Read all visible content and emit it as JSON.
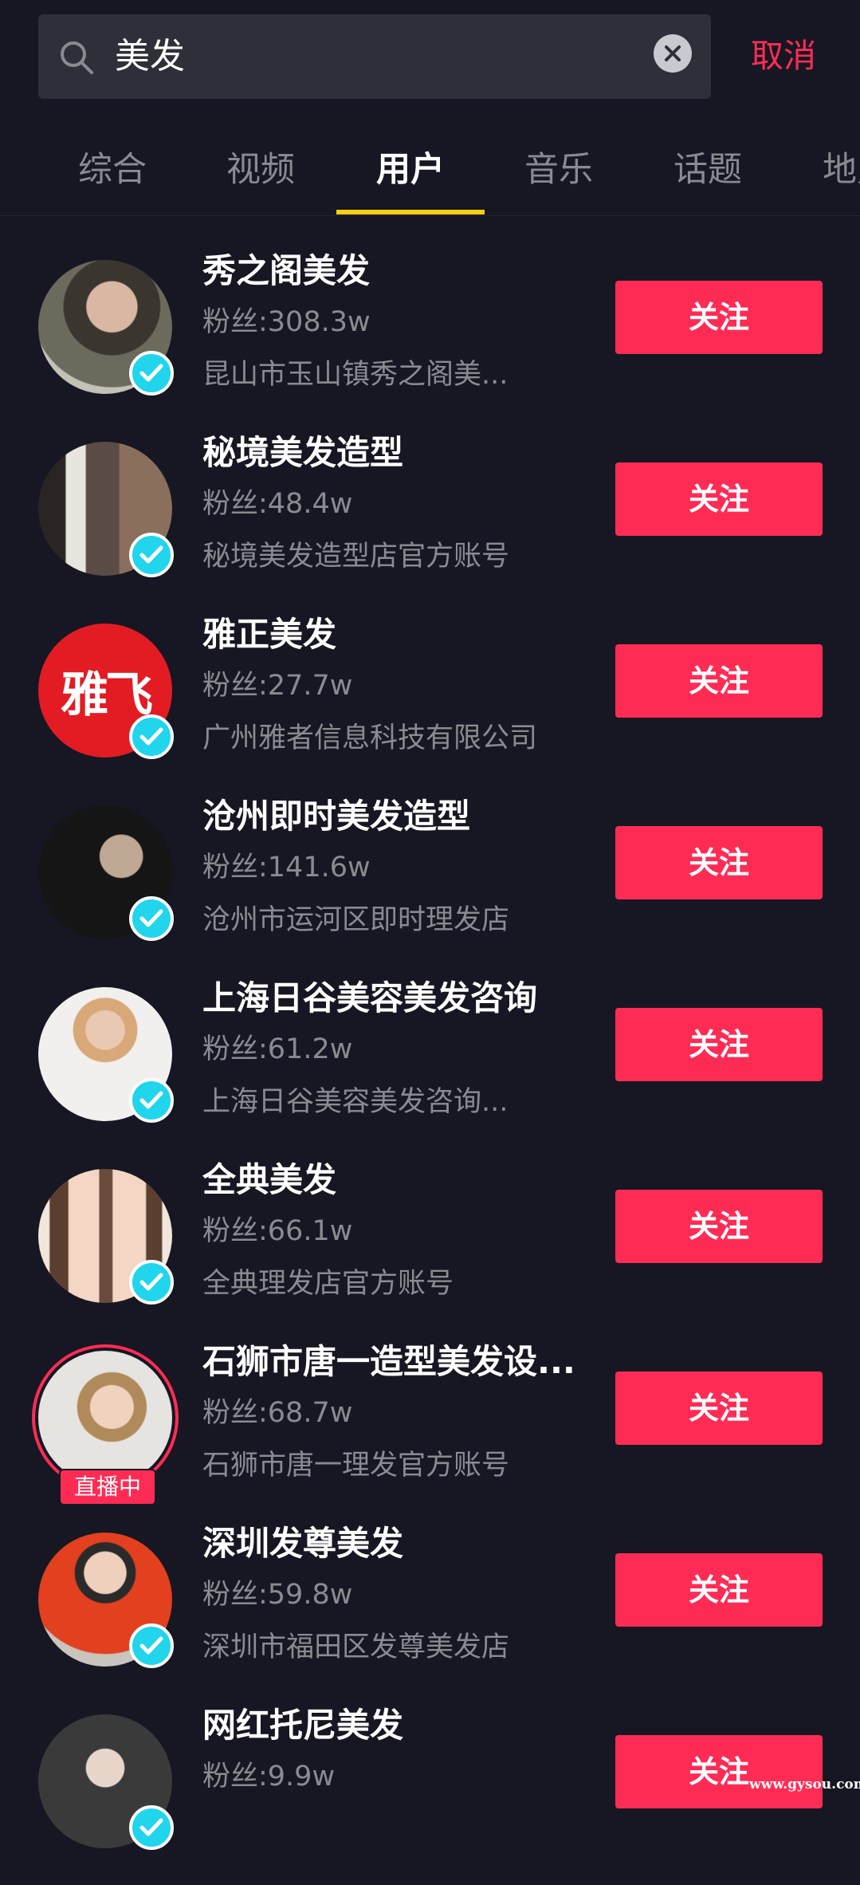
{
  "search": {
    "query": "美发",
    "cancel_label": "取消"
  },
  "tabs": [
    {
      "label": "综合",
      "active": false
    },
    {
      "label": "视频",
      "active": false
    },
    {
      "label": "用户",
      "active": true
    },
    {
      "label": "音乐",
      "active": false
    },
    {
      "label": "话题",
      "active": false
    },
    {
      "label": "地点",
      "active": false
    }
  ],
  "users": [
    {
      "name": "秀之阁美发",
      "fans": "粉丝:308.3w",
      "desc": "昆山市玉山镇秀之阁美...",
      "verified": true,
      "live": false,
      "follow_label": "关注"
    },
    {
      "name": "秘境美发造型",
      "fans": "粉丝:48.4w",
      "desc": "秘境美发造型店官方账号",
      "verified": true,
      "live": false,
      "follow_label": "关注"
    },
    {
      "name": "雅正美发",
      "fans": "粉丝:27.7w",
      "desc": "广州雅者信息科技有限公司",
      "verified": true,
      "live": false,
      "follow_label": "关注",
      "logo_text": "雅飞"
    },
    {
      "name": "沧州即时美发造型",
      "fans": "粉丝:141.6w",
      "desc": "沧州市运河区即时理发店",
      "verified": true,
      "live": false,
      "follow_label": "关注"
    },
    {
      "name": "上海日谷美容美发咨询",
      "fans": "粉丝:61.2w",
      "desc": "上海日谷美容美发咨询...",
      "verified": true,
      "live": false,
      "follow_label": "关注"
    },
    {
      "name": "全典美发",
      "fans": "粉丝:66.1w",
      "desc": "全典理发店官方账号",
      "verified": true,
      "live": false,
      "follow_label": "关注"
    },
    {
      "name": "石狮市唐一造型美发设...",
      "fans": "粉丝:68.7w",
      "desc": "石狮市唐一理发官方账号",
      "verified": false,
      "live": true,
      "live_label": "直播中",
      "follow_label": "关注"
    },
    {
      "name": "深圳发尊美发",
      "fans": "粉丝:59.8w",
      "desc": "深圳市福田区发尊美发店",
      "verified": true,
      "live": false,
      "follow_label": "关注"
    },
    {
      "name": "网红托尼美发",
      "fans": "粉丝:9.9w",
      "desc": "",
      "verified": true,
      "live": false,
      "follow_label": "关注"
    }
  ],
  "watermark": "www.gysou.com",
  "colors": {
    "background": "#161722",
    "accent": "#fe2c55",
    "tab_indicator": "#face15",
    "verified": "#20d5ec"
  }
}
